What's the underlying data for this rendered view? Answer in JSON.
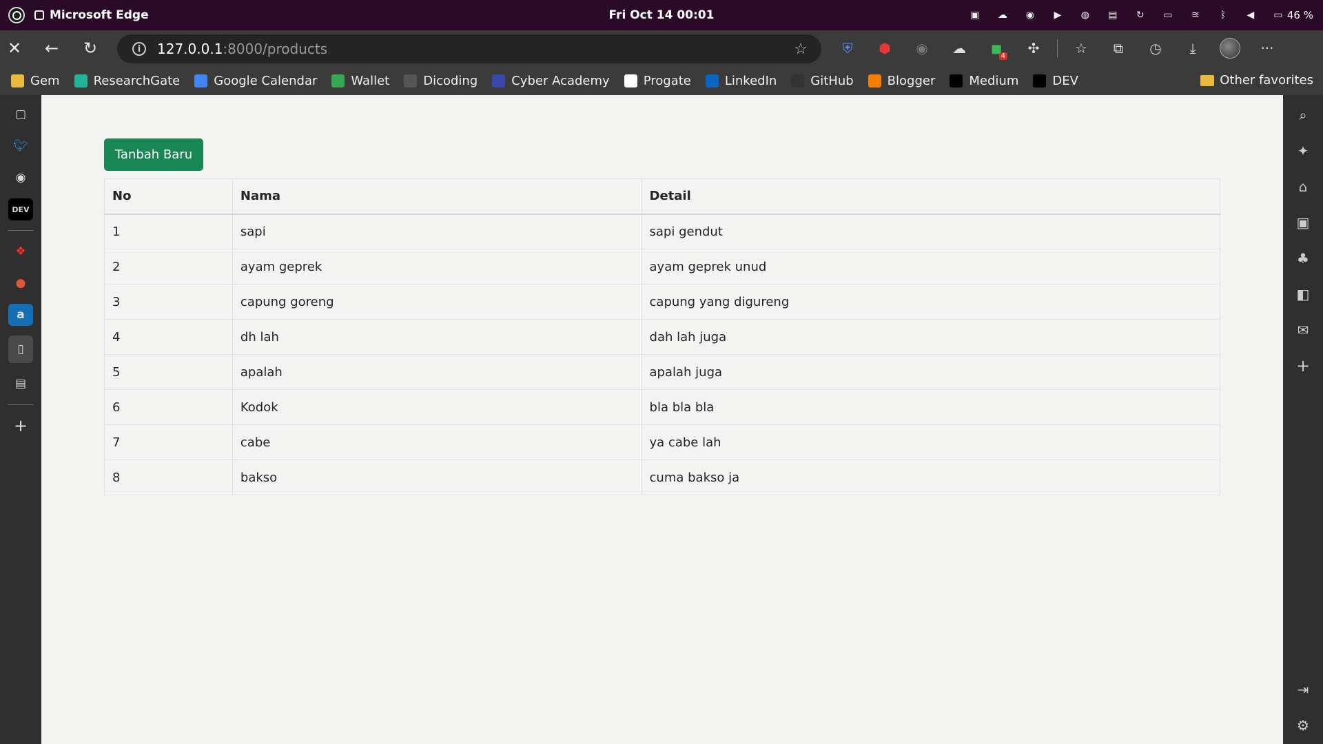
{
  "os": {
    "app_name": "Microsoft Edge",
    "clock": "Fri Oct 14  00:01",
    "battery": "46 %"
  },
  "browser": {
    "url_host": "127.0.0.1",
    "url_path": ":8000/products",
    "extension_badge": "4"
  },
  "bookmarks": [
    {
      "label": "Gem",
      "icon": "folder-icon",
      "color": "#e8b93b"
    },
    {
      "label": "ResearchGate",
      "icon": "researchgate-icon",
      "color": "#22b59b"
    },
    {
      "label": "Google Calendar",
      "icon": "calendar-icon",
      "color": "#4285f4"
    },
    {
      "label": "Wallet",
      "icon": "wallet-icon",
      "color": "#34a853"
    },
    {
      "label": "Dicoding",
      "icon": "dicoding-icon",
      "color": "#555555"
    },
    {
      "label": "Cyber Academy",
      "icon": "shield-icon",
      "color": "#3949ab"
    },
    {
      "label": "Progate",
      "icon": "progate-icon",
      "color": "#ffffff"
    },
    {
      "label": "LinkedIn",
      "icon": "linkedin-icon",
      "color": "#0a66c2"
    },
    {
      "label": "GitHub",
      "icon": "github-icon",
      "color": "#333333"
    },
    {
      "label": "Blogger",
      "icon": "blogger-icon",
      "color": "#f57d00"
    },
    {
      "label": "Medium",
      "icon": "medium-icon",
      "color": "#000000"
    },
    {
      "label": "DEV",
      "icon": "dev-icon",
      "color": "#000000"
    }
  ],
  "other_favorites": "Other favorites",
  "page": {
    "add_button": "Tanbah Baru",
    "accent_color": "#198754",
    "table": {
      "headers": [
        "No",
        "Nama",
        "Detail"
      ],
      "rows": [
        [
          "1",
          "sapi",
          "sapi gendut"
        ],
        [
          "2",
          "ayam geprek",
          "ayam geprek unud"
        ],
        [
          "3",
          "capung goreng",
          "capung yang digureng"
        ],
        [
          "4",
          "dh lah",
          "dah lah juga"
        ],
        [
          "5",
          "apalah",
          "apalah juga"
        ],
        [
          "6",
          "Kodok",
          "bla bla bla"
        ],
        [
          "7",
          "cabe",
          "ya cabe lah"
        ],
        [
          "8",
          "bakso",
          "cuma bakso ja"
        ]
      ]
    }
  }
}
